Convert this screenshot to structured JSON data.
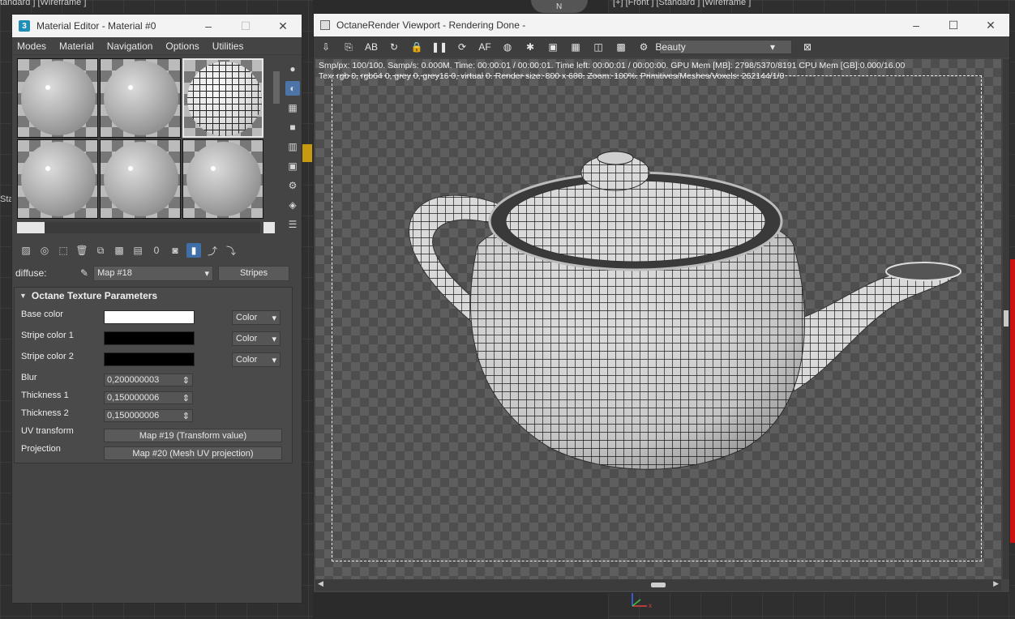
{
  "background": {
    "viewport_top_label": "[+] [Front ] [Standard ] [Wireframe ]",
    "viewport_left_label": "tandard ] [Wireframe ]",
    "left_edge_label": "Star",
    "compass_label": "N"
  },
  "material_editor": {
    "title": "Material Editor - Material #0",
    "menu": [
      "Modes",
      "Material",
      "Navigation",
      "Options",
      "Utilities"
    ],
    "diffuse_label": "diffuse:",
    "map_select": "Map #18",
    "map_type_button": "Stripes",
    "rollout_title": "Octane Texture Parameters",
    "params": {
      "base_color": {
        "label": "Base color",
        "mode": "Color",
        "swatch": "#ffffff"
      },
      "stripe_color_1": {
        "label": "Stripe color 1",
        "mode": "Color",
        "swatch": "#000000"
      },
      "stripe_color_2": {
        "label": "Stripe color 2",
        "mode": "Color",
        "swatch": "#000000"
      },
      "blur": {
        "label": "Blur",
        "value": "0,200000003"
      },
      "thickness_1": {
        "label": "Thickness 1",
        "value": "0,150000006"
      },
      "thickness_2": {
        "label": "Thickness 2",
        "value": "0,150000006"
      },
      "uv_transform": {
        "label": "UV transform",
        "value": "Map #19 (Transform value)"
      },
      "projection": {
        "label": "Projection",
        "value": "Map #20 (Mesh UV projection)"
      }
    }
  },
  "octane": {
    "title": "OctaneRender Viewport - Rendering Done -",
    "pass_select": "Beauty",
    "stats_line_1": "Smp/px: 100/100.   Samp/s: 0.000M.   Time: 00:00:01 / 00:00:01.   Time left: 00:00:01 / 00:00:00.   GPU Mem [MB]: 2798/5370/8191   CPU Mem [GB]:0.000/16.00",
    "stats_line_2": "Tex: rgb 0, rgb64 0, grey 0, grey16 0, virtual 0.   Render size: 800 x 600.   Zoom: 100%.   Primitives/Meshes/Voxels: 262144/1/0"
  },
  "colors": {
    "accent": "#4c74a8",
    "title_bar": "#f3f3f3",
    "panel": "#444444"
  }
}
